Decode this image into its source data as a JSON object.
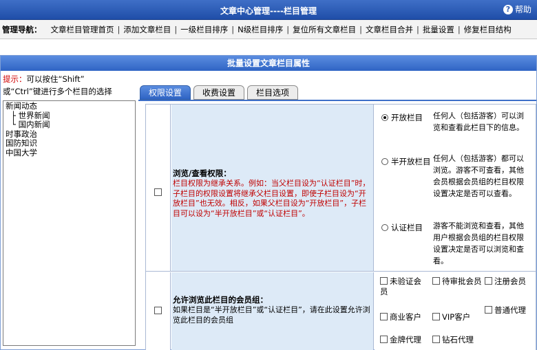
{
  "header": {
    "title": "文章中心管理----栏目管理",
    "help_label": "帮助",
    "help_icon": "?"
  },
  "nav": {
    "label": "管理导航：",
    "links": [
      "文章栏目管理首页",
      "添加文章栏目",
      "一级栏目排序",
      "N级栏目排序",
      "复位所有文章栏目",
      "文章栏目合并",
      "批量设置",
      "修复栏目结构"
    ]
  },
  "panel": {
    "title": "批量设置文章栏目属性"
  },
  "tip": {
    "key": "提示：",
    "line1": "可以按住“Shift”",
    "line2": "或“Ctrl”键进行多个栏目的选择"
  },
  "tree": [
    "新闻动态",
    "├ 世界新闻",
    "└ 国内新闻",
    "时事政治",
    "国防知识",
    "中国大学"
  ],
  "tabs": [
    "权限设置",
    "收费设置",
    "栏目选项"
  ],
  "permission": {
    "title": "浏览/查看权限：",
    "note": "栏目权限为继承关系。例如：当父栏目设为“认证栏目”时，子栏目的权限设置将继承父栏目设置，即使子栏目设为“开放栏目”也无效。相反，如果父栏目设为“开放栏目”，子栏目可以设为“半开放栏目”或“认证栏目”。",
    "options": [
      {
        "label": "开放栏目",
        "desc": "任何人（包括游客）可以浏览和查看此栏目下的信息。",
        "checked": true
      },
      {
        "label": "半开放栏目",
        "desc": "任何人（包括游客）都可以浏览。游客不可查看，其他会员根据会员组的栏目权限设置决定是否可以查看。",
        "checked": false
      },
      {
        "label": "认证栏目",
        "desc": "游客不能浏览和查看，其他用户根据会员组的栏目权限设置决定是否可以浏览和查看。",
        "checked": false
      }
    ]
  },
  "groups": {
    "title": "允许浏览此栏目的会员组：",
    "note": "如果栏目是“半开放栏目”或“认证栏目”，请在此设置允许浏览此栏目的会员组",
    "items": [
      "未验证会员",
      "待审批会员",
      "注册会员",
      "商业客户",
      "VIP客户",
      "普通代理",
      "金牌代理",
      "钻石代理"
    ]
  }
}
